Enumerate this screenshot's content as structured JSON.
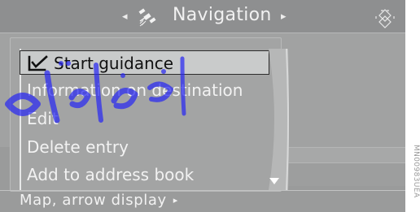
{
  "header": {
    "title": "Navigation",
    "left_arrow": "◂",
    "right_arrow": "▸",
    "icons": [
      "satellite-icon",
      "controller-icon"
    ]
  },
  "menu": {
    "items": [
      {
        "label": "Start guidance",
        "selected": true,
        "icon": "checkmark-icon"
      },
      {
        "label": "Information on destination"
      },
      {
        "label": "Edit"
      },
      {
        "label": "Delete entry"
      },
      {
        "label": "Add to address book"
      }
    ],
    "scroll_icon": "scroll-down-icon"
  },
  "footer": {
    "label": "Map, arrow display",
    "arrow": "▸"
  },
  "side_code": "MN00983UEA",
  "watermark_text": "امداد خودرو",
  "colors": {
    "screen_bg": "#9a9b9b",
    "header_bg": "#8e8f90",
    "text": "#f2f2f2",
    "selected_bg": "#c9cbcb",
    "watermark": "#2323ff"
  }
}
